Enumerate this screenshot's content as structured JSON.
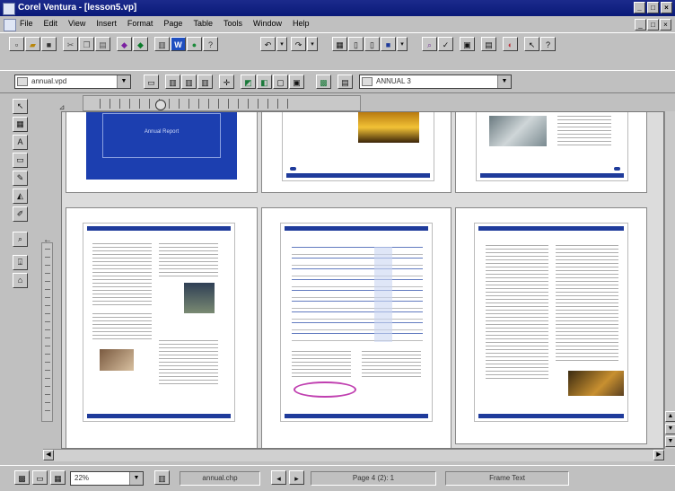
{
  "window": {
    "title": "Corel Ventura - [lesson5.vp]"
  },
  "window_controls": {
    "minimize": "_",
    "maximize": "□",
    "close": "×"
  },
  "menu": {
    "items": [
      "File",
      "Edit",
      "View",
      "Insert",
      "Format",
      "Page",
      "Table",
      "Tools",
      "Window",
      "Help"
    ]
  },
  "style_toolbar": {
    "chapter_combo": "annual.vpd",
    "tag_combo": "ANNUAL 3"
  },
  "status": {
    "zoom": "22%",
    "chapter": "annual.chp",
    "page": "Page 4 (2): 1",
    "mode": "Frame Text"
  },
  "icons": {
    "toolbar1": [
      "new-icon",
      "open-icon",
      "save-icon",
      "cut-icon",
      "copy-icon",
      "paste-icon",
      "print-icon",
      "word-icon",
      "web-icon",
      "help-icon",
      "undo-icon",
      "redo-icon",
      "frame-icon",
      "color-icon",
      "find-icon",
      "spell-icon",
      "publish-icon",
      "whats-this-icon"
    ],
    "tools": [
      "pick-tool-icon",
      "frame-tool-icon",
      "text-tool-icon",
      "shape-tool-icon",
      "freehand-tool-icon",
      "fill-tool-icon",
      "outline-tool-icon",
      "zoom-tool-icon",
      "tag-tool-icon",
      "table-tool-icon"
    ]
  },
  "pages": {
    "cover_title": "Annual Report"
  },
  "colors": {
    "brand_blue": "#1f3b9b",
    "cover_blue": "#1c3fb0",
    "titlebar": "#0a1a78"
  }
}
